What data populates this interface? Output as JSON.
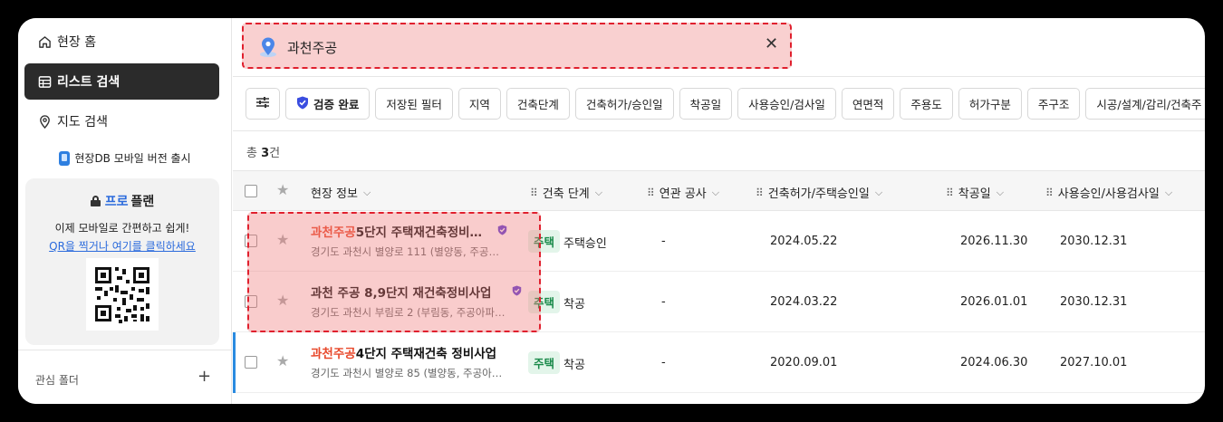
{
  "sidebar": {
    "nav": [
      {
        "label": "현장 홈",
        "icon": "home-icon"
      },
      {
        "label": "리스트 검색",
        "icon": "table-icon"
      },
      {
        "label": "지도 검색",
        "icon": "map-pin-icon"
      }
    ],
    "mobile_banner": "현장DB 모바일 버전 출시",
    "pro_card": {
      "title_pro": "프로",
      "title_rest": "플랜",
      "desc": "이제 모바일로 간편하고 쉽게!",
      "link": "QR을 찍거나 여기를 클릭하세요"
    },
    "folder_label": "관심 폴더",
    "folder_add": "+"
  },
  "search": {
    "value": "과천주공",
    "close": "✕"
  },
  "filters": [
    "저장된 필터",
    "지역",
    "건축단계",
    "건축허가/승인일",
    "착공일",
    "사용승인/검사일",
    "연면적",
    "주용도",
    "허가구분",
    "주구조",
    "시공/설계/감리/건축주"
  ],
  "verified_label": "검증 완료",
  "total": {
    "prefix": "총",
    "count": "3",
    "suffix": "건"
  },
  "columns": {
    "info": "현장 정보",
    "stage": "건축 단계",
    "related": "연관 공사",
    "permit": "건축허가/주택승인일",
    "start": "착공일",
    "approval": "사용승인/사용검사일"
  },
  "rows": [
    {
      "title_hl": "과천주공",
      "title_rest": "5단지 주택재건축정비…",
      "verified": true,
      "address": "경기도 과천시 별양로 111 (별양동, 주공…",
      "badge": "주택",
      "stage": "주택승인",
      "related": "-",
      "permit": "2024.05.22",
      "start": "2026.11.30",
      "approval": "2030.12.31"
    },
    {
      "title_hl": "",
      "title_rest": "과천 주공 8,9단지 재건축정비사업",
      "verified": true,
      "address": "경기도 과천시 부림로 2 (부림동, 주공아파…",
      "badge": "주택",
      "stage": "착공",
      "related": "-",
      "permit": "2024.03.22",
      "start": "2026.01.01",
      "approval": "2030.12.31"
    },
    {
      "title_hl": "과천주공",
      "title_rest": "4단지 주택재건축 정비사업",
      "verified": false,
      "address": "경기도 과천시 별양로 85 (별양동, 주공아…",
      "badge": "주택",
      "stage": "착공",
      "related": "-",
      "permit": "2020.09.01",
      "start": "2024.06.30",
      "approval": "2027.10.01"
    }
  ],
  "colors": {
    "accent_blue": "#2c6bdc",
    "highlight_red": "#e8492c",
    "badge_green": "#1a8a4a",
    "verified_purple": "#5b3fd6"
  }
}
